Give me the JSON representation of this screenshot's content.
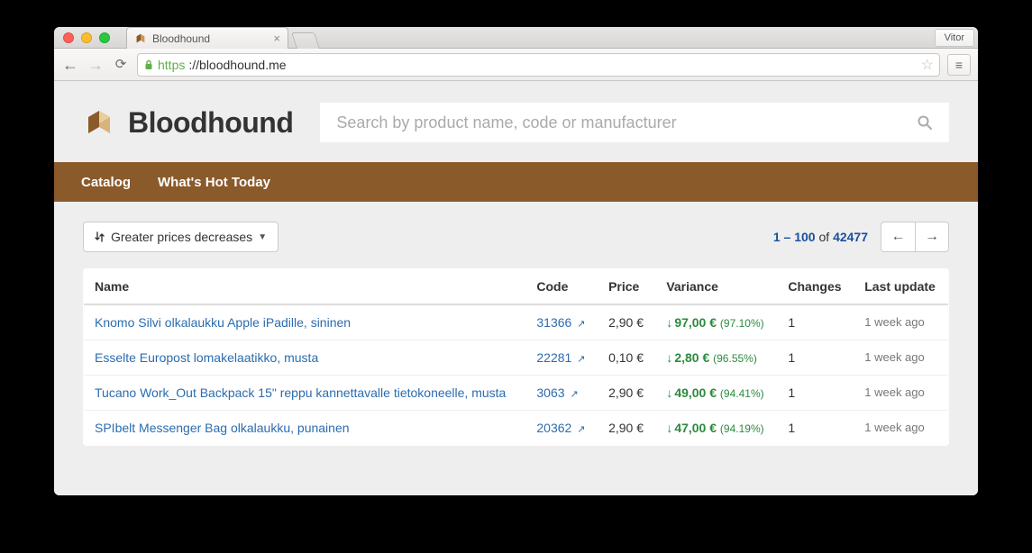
{
  "browser": {
    "profile_label": "Vitor",
    "tab_title": "Bloodhound",
    "url_scheme": "https",
    "url_host": "://bloodhound.me"
  },
  "header": {
    "app_name": "Bloodhound",
    "search_placeholder": "Search by product name, code or manufacturer"
  },
  "nav": {
    "items": [
      "Catalog",
      "What's Hot Today"
    ]
  },
  "sort": {
    "label": "Greater prices decreases"
  },
  "pagination": {
    "range": "1 – 100",
    "of_word": "of",
    "total": "42477"
  },
  "table": {
    "columns": {
      "name": "Name",
      "code": "Code",
      "price": "Price",
      "variance": "Variance",
      "changes": "Changes",
      "last_update": "Last update"
    },
    "rows": [
      {
        "name": "Knomo Silvi olkalaukku Apple iPadille, sininen",
        "code": "31366",
        "price": "2,90 €",
        "variance_amount": "97,00 €",
        "variance_pct": "(97.10%)",
        "changes": "1",
        "last_update": "1 week ago"
      },
      {
        "name": "Esselte Europost lomakelaatikko, musta",
        "code": "22281",
        "price": "0,10 €",
        "variance_amount": "2,80 €",
        "variance_pct": "(96.55%)",
        "changes": "1",
        "last_update": "1 week ago"
      },
      {
        "name": "Tucano Work_Out Backpack 15\" reppu kannettavalle tietokoneelle, musta",
        "code": "3063",
        "price": "2,90 €",
        "variance_amount": "49,00 €",
        "variance_pct": "(94.41%)",
        "changes": "1",
        "last_update": "1 week ago"
      },
      {
        "name": "SPIbelt Messenger Bag olkalaukku, punainen",
        "code": "20362",
        "price": "2,90 €",
        "variance_amount": "47,00 €",
        "variance_pct": "(94.19%)",
        "changes": "1",
        "last_update": "1 week ago"
      }
    ]
  }
}
